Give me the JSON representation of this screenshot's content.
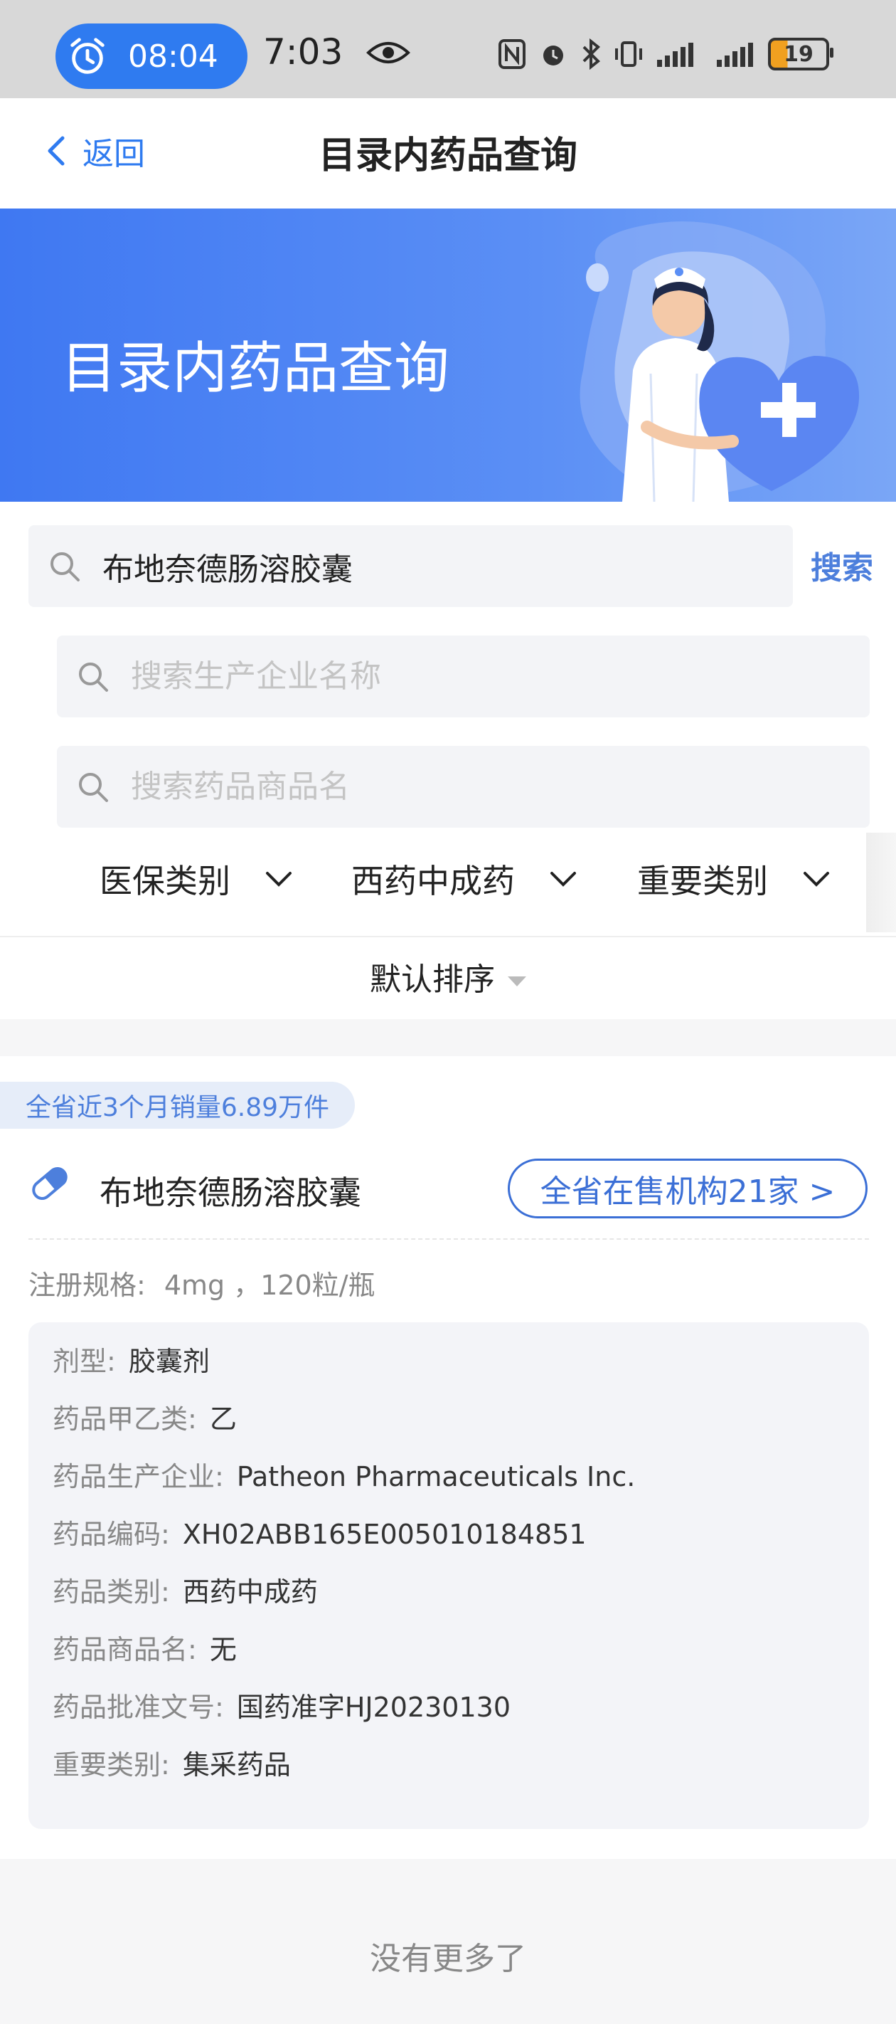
{
  "status_bar": {
    "alarm_time": "08:04",
    "clock": "7:03",
    "battery": "19"
  },
  "nav": {
    "back_label": "返回",
    "title": "目录内药品查询"
  },
  "banner": {
    "title": "目录内药品查询"
  },
  "search": {
    "query": "布地奈德肠溶胶囊",
    "button": "搜索",
    "company_placeholder": "搜索生产企业名称",
    "brand_placeholder": "搜索药品商品名"
  },
  "filters": {
    "items": [
      "医保类别",
      "西药中成药",
      "重要类别"
    ],
    "sort": "默认排序"
  },
  "result": {
    "sales_tag": "全省近3个月销量6.89万件",
    "name": "布地奈德肠溶胶囊",
    "stores_button": "全省在售机构21家 >",
    "spec_label": "注册规格:",
    "spec_value": "4mg ，120粒/瓶",
    "details": [
      {
        "label": "剂型:",
        "value": "胶囊剂"
      },
      {
        "label": "药品甲乙类:",
        "value": "乙"
      },
      {
        "label": "药品生产企业:",
        "value": "Patheon Pharmaceuticals Inc."
      },
      {
        "label": "药品编码:",
        "value": "XH02ABB165E005010184851"
      },
      {
        "label": "药品类别:",
        "value": "西药中成药"
      },
      {
        "label": "药品商品名:",
        "value": "无"
      },
      {
        "label": "药品批准文号:",
        "value": "国药准字HJ20230130"
      },
      {
        "label": "重要类别:",
        "value": "集采药品"
      }
    ]
  },
  "footer": {
    "no_more": "没有更多了"
  },
  "colors": {
    "accent": "#2f7bf0",
    "banner": "#4a82f3",
    "link": "#3b6fd6"
  }
}
